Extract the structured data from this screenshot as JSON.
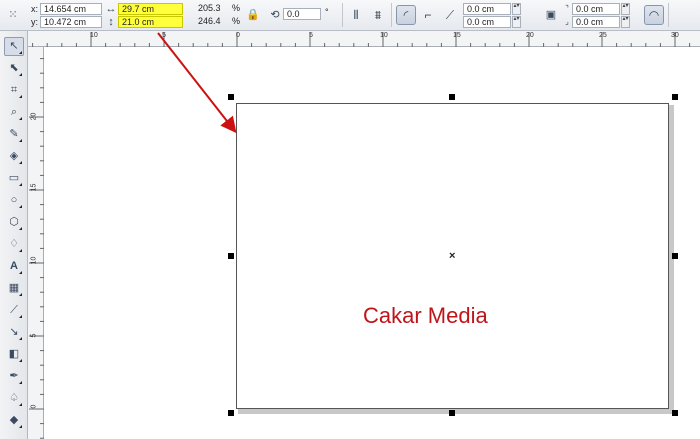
{
  "propbar": {
    "x_label": "x:",
    "x_value": "14.654 cm",
    "y_label": "y:",
    "y_value": "10.472 cm",
    "width_value": "29.7 cm",
    "height_value": "21.0 cm",
    "scale_x": "205.3",
    "scale_y": "246.4",
    "percent": "%",
    "rotation_value": "0.0",
    "degree": "°",
    "corner_tl": "0.0 cm",
    "corner_bl": "0.0 cm",
    "corner_tr": "0.0 cm",
    "corner_br": "0.0 cm"
  },
  "hruler": {
    "unit_icon": "↕",
    "ticks": [
      "10",
      "5",
      "0",
      "5",
      "10",
      "15",
      "20",
      "25",
      "30"
    ]
  },
  "vruler": {
    "ticks": [
      "20",
      "15",
      "10",
      "5",
      "0"
    ]
  },
  "toolbox": {
    "items": [
      "pick-icon",
      "shape-icon",
      "crop-icon",
      "zoom-icon",
      "freehand-icon",
      "smart-fill-icon",
      "rectangle-icon",
      "ellipse-icon",
      "polygon-icon",
      "basic-shapes-icon",
      "text-icon",
      "table-icon",
      "dimension-icon",
      "connector-icon",
      "blend-icon",
      "transparency-icon",
      "eyedropper-icon",
      "outline-icon",
      "fill-icon",
      "interactive-fill-icon"
    ]
  },
  "canvas": {
    "page_text": "Cakar Media",
    "text_color": "#c0141b",
    "arrow_color": "#cc1111"
  }
}
